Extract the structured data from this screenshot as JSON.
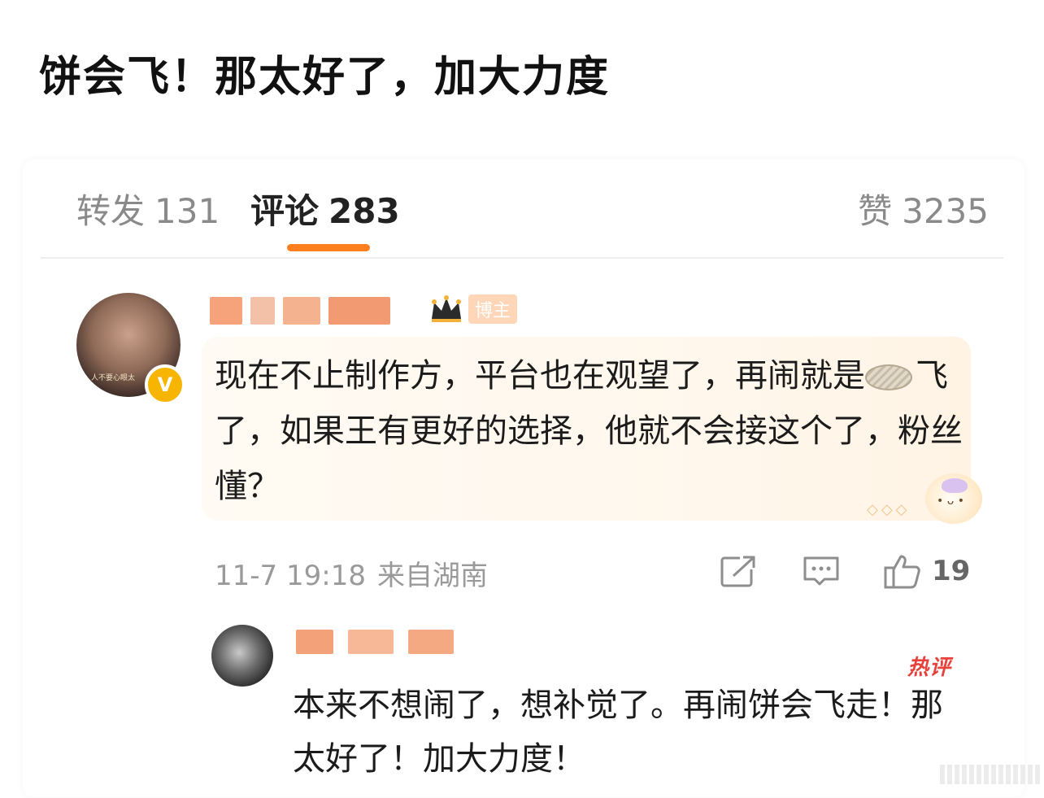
{
  "headline": "饼会飞！那太好了，加大力度",
  "tabs": {
    "repost": {
      "label": "转发",
      "count": "131"
    },
    "comment": {
      "label": "评论",
      "count": "283"
    },
    "like": {
      "label": "赞",
      "count": "3235"
    }
  },
  "main_comment": {
    "avatar_caption": "人不要心眼太",
    "host_label": "博主",
    "verified_badge": "V",
    "text_part1": "现在不止制作方，平台也在观望了，再闹就是",
    "bread_icon": "bread-sticker-icon",
    "text_part2": "飞了，如果王有更好的选择，他就不会接这个了，粉丝懂？",
    "time": "11-7 19:18",
    "location": "来自湖南",
    "likes": "19"
  },
  "reply": {
    "hot_label": "热评",
    "text": "本来不想闹了，想补觉了。再闹饼会飞走！那太好了！加大力度！"
  },
  "icons": {
    "share": "share-icon",
    "reply": "comment-icon",
    "like": "thumbs-up-icon"
  },
  "colors": {
    "accent": "#ff7f1e",
    "hot": "#e8413b",
    "muted": "#8a8a8a"
  }
}
